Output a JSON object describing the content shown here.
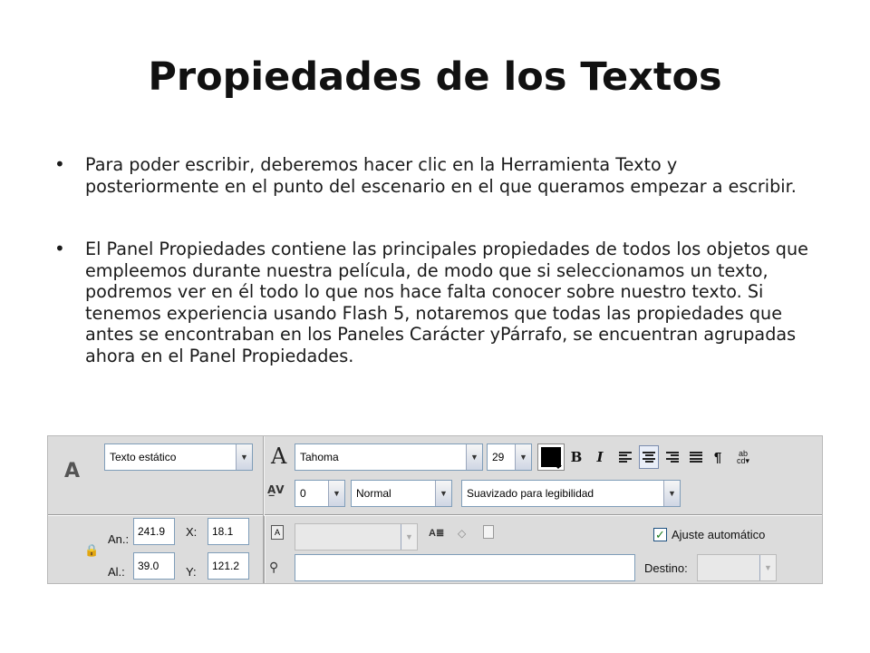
{
  "slide": {
    "title": "Propiedades de los Textos",
    "bullet_glyph": "•",
    "bullets": [
      "Para poder escribir, deberemos hacer clic en la Herramienta Texto y posteriormente en el punto del escenario en el que queramos empezar a escribir.",
      "El Panel Propiedades contiene las principales propiedades de todos los objetos que empleemos durante nuestra película, de modo que si seleccionamos un texto, podremos ver en él todo lo que nos hace falta conocer sobre nuestro texto. Si tenemos experiencia usando Flash 5, notaremos que todas las propiedades que antes se encontraban en los Paneles Carácter yPárrafo, se encuentran agrupadas ahora en el Panel Propiedades."
    ]
  },
  "panel": {
    "tool_letter": "A",
    "text_type": "Texto estático",
    "font_icon": "A",
    "font_name": "Tahoma",
    "font_size": "29",
    "text_color": "#000000",
    "bold_label": "B",
    "italic_label": "I",
    "paragraph_label": "¶",
    "spacing_icon_label": "A̲V",
    "letter_spacing": "0",
    "position_mode": "Normal",
    "antialias": "Suavizado para legibilidad",
    "width_label": "An.:",
    "width_value": "241.9",
    "height_label": "Al.:",
    "height_value": "39.0",
    "x_label": "X:",
    "x_value": "18.1",
    "y_label": "Y:",
    "y_value": "121.2",
    "auto_kern_label": "Ajuste automático",
    "auto_kern_checked": "✓",
    "target_label": "Destino:",
    "lock_icon": "🔒",
    "dropdown_glyph": "▼"
  }
}
